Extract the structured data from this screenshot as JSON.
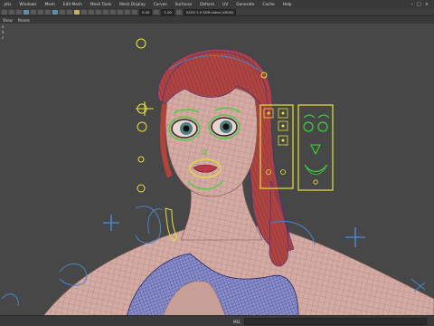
{
  "menu": [
    {
      "id": "file",
      "label": "ptis"
    },
    {
      "id": "windows",
      "label": "Windows"
    },
    {
      "id": "mesh",
      "label": "Mesh"
    },
    {
      "id": "edit_mesh",
      "label": "Edit Mesh"
    },
    {
      "id": "mesh_tools",
      "label": "Mesh Tools"
    },
    {
      "id": "mesh_display",
      "label": "Mesh Display"
    },
    {
      "id": "curves",
      "label": "Curves"
    },
    {
      "id": "surfaces",
      "label": "Surfaces"
    },
    {
      "id": "deform",
      "label": "Deform"
    },
    {
      "id": "uv",
      "label": "UV"
    },
    {
      "id": "generate",
      "label": "Generate"
    },
    {
      "id": "cache",
      "label": "Cache"
    },
    {
      "id": "help",
      "label": "Help"
    }
  ],
  "toolbar": {
    "value_a": "0.00",
    "value_b": "1.00",
    "colorspace": "ACES 1.0 SDR-video (sRGB)"
  },
  "subbar": {
    "show": "Show",
    "panels": "Panels"
  },
  "left_strip": [
    "a",
    "b",
    "c"
  ],
  "status": {
    "mel_label": "MEL"
  },
  "window_controls": {
    "minimize": "–",
    "maximize": "□",
    "close": "×"
  },
  "colors": {
    "viewport_bg": "#474747",
    "skin_wire": "#d9b0a8",
    "hair": "#a83a2c",
    "blue_wire": "#3a3c9a",
    "ctrl_yellow": "#e6e23a",
    "ctrl_green": "#3cd23c",
    "ctrl_blue": "#4a84c8"
  }
}
